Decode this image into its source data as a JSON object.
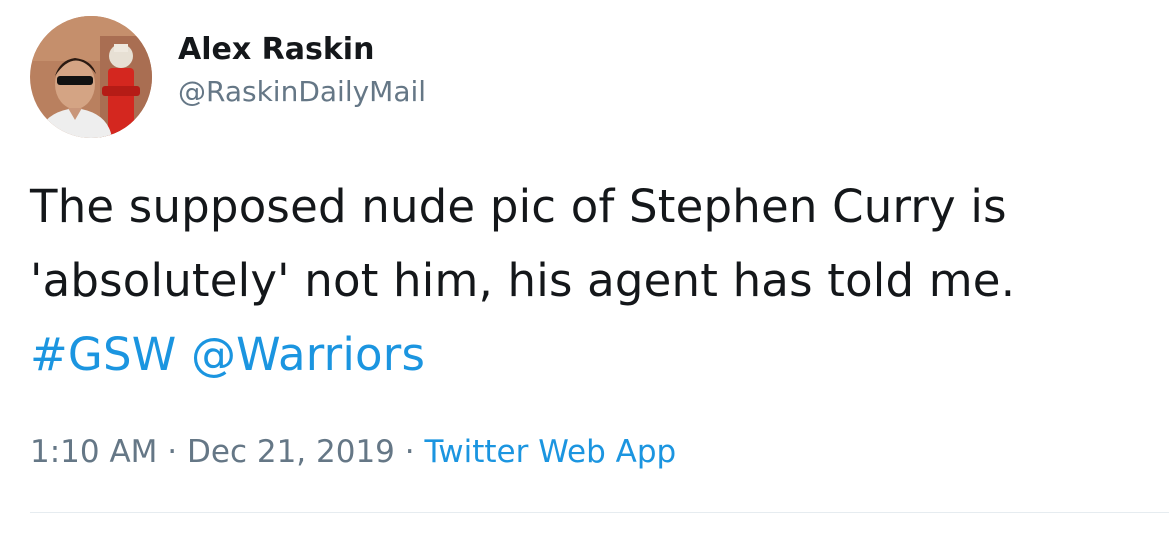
{
  "author": {
    "display_name": "Alex Raskin",
    "handle": "@RaskinDailyMail"
  },
  "tweet": {
    "text_line1": "The supposed nude pic of Stephen Curry is",
    "text_line2": "'absolutely' not him, his agent has told me.",
    "hashtag": "#GSW",
    "mention": "@Warriors"
  },
  "meta": {
    "time": "1:10 AM",
    "separator": "·",
    "date": "Dec 21, 2019",
    "source": "Twitter Web App"
  },
  "colors": {
    "link": "#1b95e0",
    "secondary_text": "#657786",
    "primary_text": "#14171a",
    "divider": "#e6ecf0"
  }
}
